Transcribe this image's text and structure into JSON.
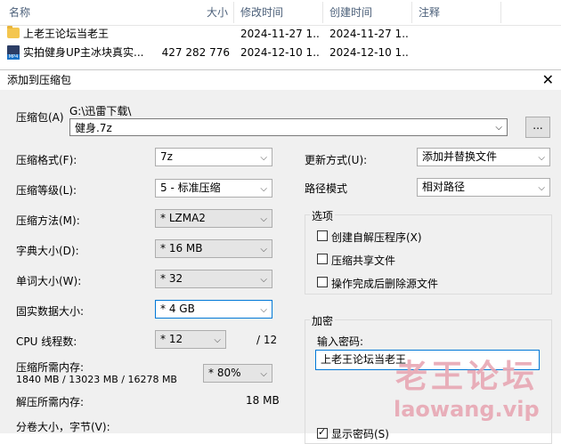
{
  "file_list": {
    "columns": [
      "名称",
      "大小",
      "修改时间",
      "创建时间",
      "注释"
    ],
    "rows": [
      {
        "name": "上老王论坛当老王",
        "size": "",
        "modified": "2024-11-27 1...",
        "created": "2024-11-27 1...",
        "icon": "folder-icon"
      },
      {
        "name": "实拍健身UP主冰块真实...",
        "size": "427 282 776",
        "modified": "2024-12-10 1...",
        "created": "2024-12-10 1...",
        "icon": "video-file-icon",
        "icon_text": "MP4"
      }
    ]
  },
  "dialog": {
    "title": "添加到压缩包",
    "close": "✕",
    "archive_label": "压缩包(A)",
    "archive_path": "G:\\迅雷下载\\",
    "archive_name": "健身.7z",
    "browse_label": "...",
    "format_label": "压缩格式(F):",
    "format_value": "7z",
    "level_label": "压缩等级(L):",
    "level_value": "5 - 标准压缩",
    "method_label": "压缩方法(M):",
    "method_value": "* LZMA2",
    "dict_label": "字典大小(D):",
    "dict_value": "* 16 MB",
    "word_label": "单词大小(W):",
    "word_value": "* 32",
    "solid_label": "固实数据大小:",
    "solid_value": "* 4 GB",
    "threads_label": "CPU 线程数:",
    "threads_value": "* 12",
    "threads_max": "/ 12",
    "mem_label": "压缩所需内存:",
    "mem_value": "1840 MB / 13023 MB / 16278 MB",
    "mem_percent": "* 80%",
    "decomp_label": "解压所需内存:",
    "decomp_value": "18 MB",
    "split_label": "分卷大小，字节(V):",
    "update_label": "更新方式(U):",
    "update_value": "添加并替换文件",
    "path_label": "路径模式",
    "path_value": "相对路径",
    "options_title": "选项",
    "opt_sfx": "创建自解压程序(X)",
    "opt_shared": "压缩共享文件",
    "opt_delete": "操作完成后删除源文件",
    "enc_title": "加密",
    "pwd_label": "输入密码:",
    "pwd_value": "上老王论坛当老王",
    "show_pwd": "显示密码(S)"
  },
  "watermark": {
    "line1": "老王论坛",
    "line2": "laowang.vip"
  }
}
